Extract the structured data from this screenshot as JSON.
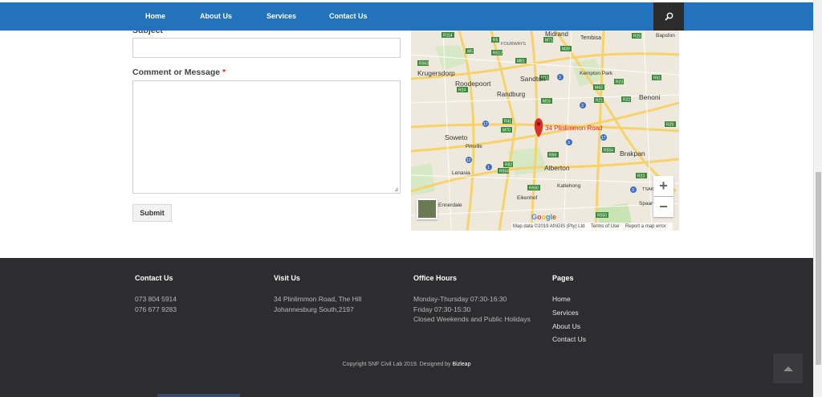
{
  "nav": {
    "items": [
      {
        "label": "Home"
      },
      {
        "label": "About Us"
      },
      {
        "label": "Services"
      },
      {
        "label": "Contact Us"
      }
    ],
    "search_icon": "search-icon"
  },
  "form": {
    "subject_label": "Subject",
    "message_label": "Comment or Message",
    "required_mark": "*",
    "subject_value": "",
    "message_value": "",
    "submit_label": "Submit"
  },
  "map": {
    "marker_label": "34 Plinlimmon Road",
    "places": [
      "Midrand",
      "Tembisa",
      "Bapsfon",
      "FOURWAYS",
      "Krugersdorp",
      "Roodepoort",
      "Sandton",
      "Kempton Park",
      "Randburg",
      "Benoni",
      "Soweto",
      "Pimville",
      "Brakpan",
      "Lenasia",
      "Alberton",
      "Katlehong",
      "Eikenhof",
      "Ennerdale",
      "Spaar",
      "TSAK"
    ],
    "zoom_in": "+",
    "zoom_out": "−",
    "attribution": {
      "data": "Map data ©2019 AfriGIS (Pty) Ltd",
      "terms": "Terms of Use",
      "report": "Report a map error"
    },
    "google": "Google"
  },
  "footer": {
    "contact": {
      "heading": "Contact Us",
      "lines": [
        "073 804 5914",
        "076 677 9283"
      ]
    },
    "visit": {
      "heading": "Visit Us",
      "lines": [
        "34 Plinlimmon Road, The Hill",
        "Johannesburg South,2197"
      ]
    },
    "hours": {
      "heading": "Office Hours",
      "lines": [
        "Monday-Thursday 07:30-16:30",
        "Friday 07:30-15:30",
        "Closed Weekends and Public Holidays"
      ]
    },
    "pages": {
      "heading": "Pages",
      "links": [
        "Home",
        "Services",
        "About Us",
        "Contact Us"
      ]
    },
    "copyright": "Copyright SNF Civil Lab 2019. Designed by",
    "designer": "Bizleap"
  },
  "colors": {
    "nav": "#2272bd",
    "footer": "#2d2d2f",
    "marker": "#d93025"
  }
}
